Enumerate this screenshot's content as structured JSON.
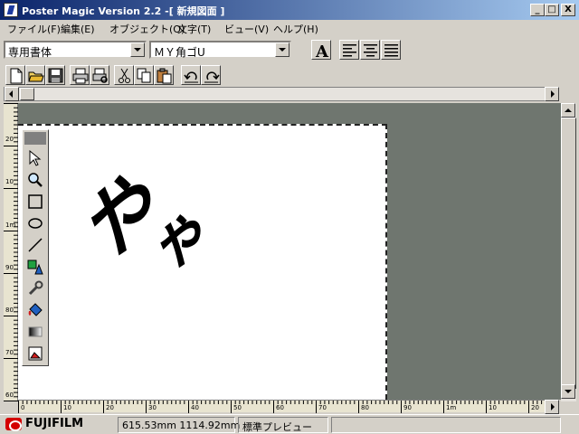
{
  "window": {
    "title": "Poster Magic Version 2.2 -[ 新規図面 ]",
    "min_label": "_",
    "max_label": "□",
    "close_label": "X"
  },
  "menu": [
    "ファイル(F)",
    "編集(E)",
    "オブジェクト(O)",
    "文字(T)",
    "ビュー(V)",
    "ヘルプ(H)"
  ],
  "font_toolbar": {
    "style_value": "専用書体",
    "font_value": "ＭＹ角ゴU"
  },
  "ruler": {
    "vertical_labels": [
      "20",
      "10",
      "1m",
      "90",
      "80",
      "70",
      "60"
    ],
    "horizontal_labels": [
      "0",
      "10",
      "20",
      "30",
      "40",
      "50",
      "60",
      "70",
      "80",
      "90",
      "1m",
      "10",
      "20"
    ]
  },
  "canvas": {
    "text_large": "や",
    "text_small": "ゃ"
  },
  "status": {
    "brand": "FUJIFILM",
    "coords": "615.53mm  1114.92mm",
    "mode": "標準プレビュー"
  },
  "colors": {
    "titlebar_start": "#0a246a",
    "workspace": "#6f766f",
    "brand_red": "#d40000"
  }
}
